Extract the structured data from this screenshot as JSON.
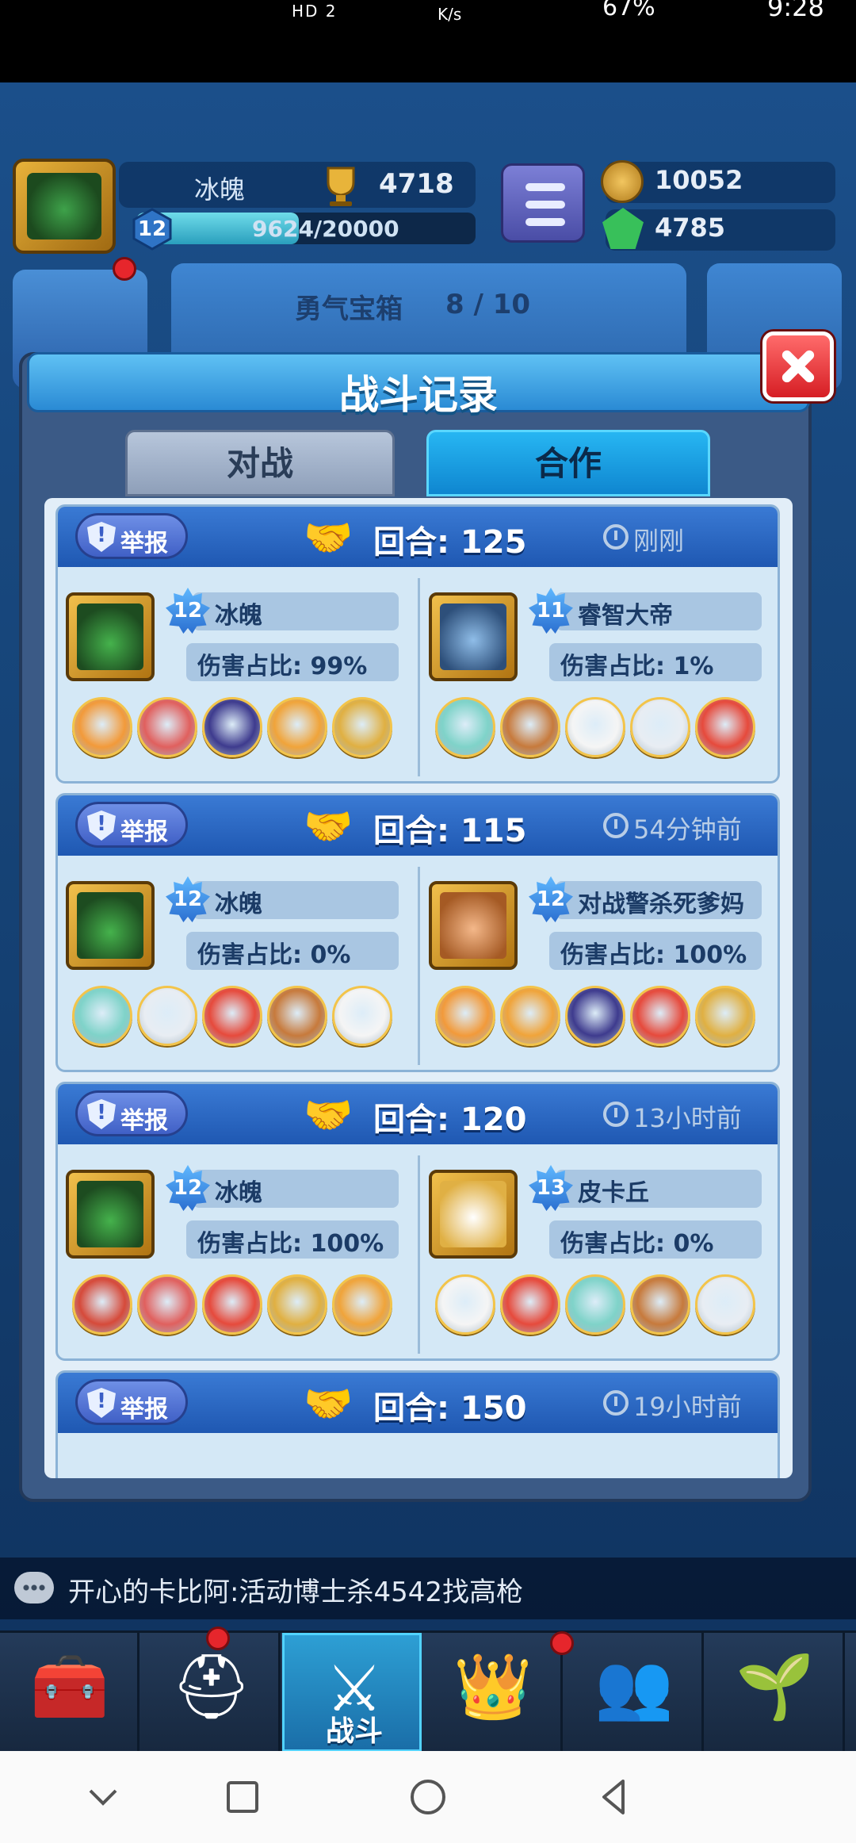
{
  "status_bar": {
    "left": "HD 2",
    "speed": "K/s",
    "right": "67%",
    "time": "9:28"
  },
  "hud": {
    "player_name": "冰魄",
    "trophies": "4718",
    "level": "12",
    "xp_text": "9624/20000",
    "xp_progress": 0.48,
    "coins": "10052",
    "gems": "4785",
    "chest_title": "勇气宝箱",
    "chest_count": "8 / 10"
  },
  "modal": {
    "title": "战斗记录",
    "tabs": [
      {
        "label": "对战",
        "active": false
      },
      {
        "label": "合作",
        "active": true
      }
    ],
    "records": [
      {
        "report": "举报",
        "round": "回合: 125",
        "time": "刚刚",
        "left": {
          "level": "12",
          "name": "冰魄",
          "damage": "伤害占比: 99%",
          "face": "face-green",
          "heroes": [
            "#f29a3a",
            "#e0605e",
            "#3e3b8e",
            "#f0a43a",
            "#e0b042"
          ]
        },
        "right": {
          "level": "11",
          "name": "睿智大帝",
          "damage": "伤害占比: 1%",
          "face": "face-pirate",
          "heroes": [
            "#7fd3c9",
            "#c77a3c",
            "#f5f5f5",
            "#e8edf3",
            "#e64a3c"
          ]
        }
      },
      {
        "report": "举报",
        "round": "回合: 115",
        "time": "54分钟前",
        "left": {
          "level": "12",
          "name": "冰魄",
          "damage": "伤害占比: 0%",
          "face": "face-green",
          "heroes": [
            "#7fd3c9",
            "#e8edf3",
            "#e64a3c",
            "#c77a3c",
            "#f5f5f5"
          ]
        },
        "right": {
          "level": "12",
          "name": "对战警杀死爹妈",
          "damage": "伤害占比: 100%",
          "face": "face-monkey",
          "heroes": [
            "#f29a3a",
            "#f0a43a",
            "#3e3b8e",
            "#e64a3c",
            "#e0b042"
          ]
        }
      },
      {
        "report": "举报",
        "round": "回合: 120",
        "time": "13小时前",
        "left": {
          "level": "12",
          "name": "冰魄",
          "damage": "伤害占比: 100%",
          "face": "face-green",
          "heroes": [
            "#d64a3a",
            "#e0605e",
            "#e64a3c",
            "#e0b042",
            "#f0a43a"
          ]
        },
        "right": {
          "level": "13",
          "name": "皮卡丘",
          "damage": "伤害占比: 0%",
          "face": "face-gold",
          "heroes": [
            "#f5f5f5",
            "#e64a3c",
            "#7fd3c9",
            "#c77a3c",
            "#e8edf3"
          ]
        }
      },
      {
        "report": "举报",
        "round": "回合: 150",
        "time": "19小时前"
      }
    ]
  },
  "chat": {
    "text": "开心的卡比阿:活动博士杀4542找高枪"
  },
  "bottom_nav": [
    {
      "id": "shop",
      "label": "",
      "glyph": "🧰"
    },
    {
      "id": "heroes",
      "label": "",
      "glyph": "⛑"
    },
    {
      "id": "battle",
      "label": "战斗",
      "glyph": "⚔",
      "active": true
    },
    {
      "id": "rank",
      "label": "",
      "glyph": "👑"
    },
    {
      "id": "social",
      "label": "",
      "glyph": "👥"
    },
    {
      "id": "garden",
      "label": "",
      "glyph": "🌱"
    }
  ]
}
